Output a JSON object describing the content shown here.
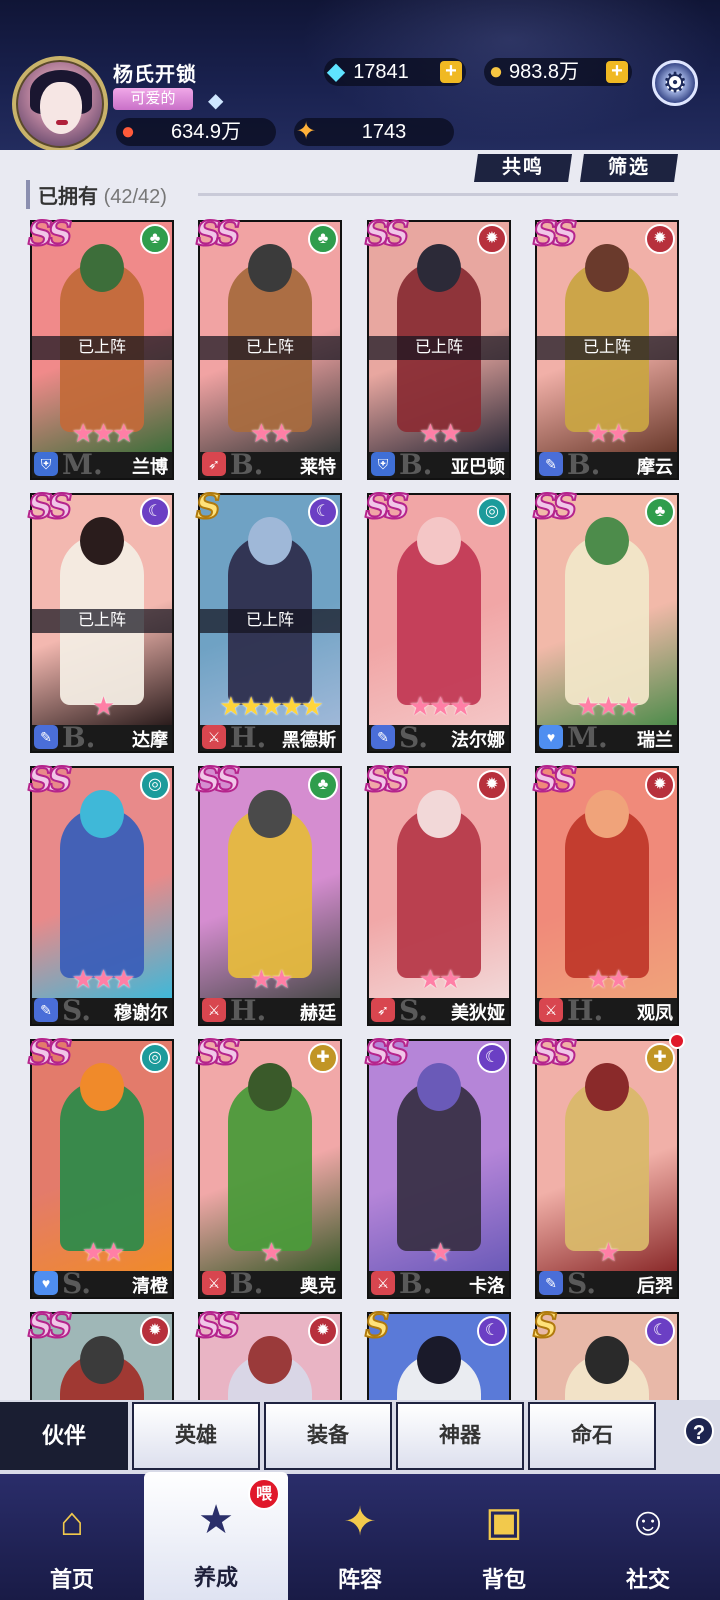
{
  "player": {
    "name": "杨氏开锁",
    "title": "可爱的",
    "rank_icon": "diamond-rank-icon"
  },
  "resources": {
    "gems": "17841",
    "gold": "983.8万",
    "power": "634.9万",
    "stars": "1743"
  },
  "actions": {
    "resonance": "共鸣",
    "filter": "筛选"
  },
  "owned": {
    "label": "已拥有",
    "count": "(42/42)"
  },
  "deployed_text": "已上阵",
  "heroes": [
    {
      "name": "兰博",
      "rank": "SS",
      "element": "nature",
      "cls": "tank",
      "letter": "M.",
      "stars": "★★★",
      "deployed": true
    },
    {
      "name": "莱特",
      "rank": "SS",
      "element": "nature",
      "cls": "ranger",
      "letter": "B.",
      "stars": "★★",
      "deployed": true
    },
    {
      "name": "亚巴顿",
      "rank": "SS",
      "element": "fire",
      "cls": "tank",
      "letter": "B.",
      "stars": "★★",
      "deployed": true
    },
    {
      "name": "摩云",
      "rank": "SS",
      "element": "fire",
      "cls": "mage",
      "letter": "B.",
      "stars": "★★",
      "deployed": true
    },
    {
      "name": "达摩",
      "rank": "SS",
      "element": "moon",
      "cls": "mage",
      "letter": "B.",
      "stars": "★",
      "deployed": true
    },
    {
      "name": "黑德斯",
      "rank": "S",
      "element": "moon",
      "cls": "warrior",
      "letter": "H.",
      "stars": "★★★★★",
      "deployed": true,
      "gold": true
    },
    {
      "name": "法尔娜",
      "rank": "SS",
      "element": "water",
      "cls": "mage",
      "letter": "S.",
      "stars": "★★★",
      "deployed": false
    },
    {
      "name": "瑞兰",
      "rank": "SS",
      "element": "nature",
      "cls": "support",
      "letter": "M.",
      "stars": "★★★",
      "deployed": false
    },
    {
      "name": "穆谢尔",
      "rank": "SS",
      "element": "water",
      "cls": "mage",
      "letter": "S.",
      "stars": "★★★",
      "deployed": false
    },
    {
      "name": "赫廷",
      "rank": "SS",
      "element": "nature",
      "cls": "warrior",
      "letter": "H.",
      "stars": "★★",
      "deployed": false
    },
    {
      "name": "美狄娅",
      "rank": "SS",
      "element": "fire",
      "cls": "ranger",
      "letter": "S.",
      "stars": "★★",
      "deployed": false
    },
    {
      "name": "观凤",
      "rank": "SS",
      "element": "fire",
      "cls": "warrior",
      "letter": "H.",
      "stars": "★★",
      "deployed": false
    },
    {
      "name": "清橙",
      "rank": "SS",
      "element": "water",
      "cls": "support",
      "letter": "S.",
      "stars": "★★",
      "deployed": false
    },
    {
      "name": "奥克",
      "rank": "SS",
      "element": "light",
      "cls": "warrior",
      "letter": "B.",
      "stars": "★",
      "deployed": false
    },
    {
      "name": "卡洛",
      "rank": "SS",
      "element": "moon",
      "cls": "warrior",
      "letter": "B.",
      "stars": "★",
      "deployed": false
    },
    {
      "name": "后羿",
      "rank": "SS",
      "element": "light",
      "cls": "mage",
      "letter": "S.",
      "stars": "★",
      "deployed": false,
      "dot": true
    },
    {
      "name": "",
      "rank": "SS",
      "element": "fire",
      "cls": "",
      "letter": "",
      "stars": "",
      "deployed": false
    },
    {
      "name": "",
      "rank": "SS",
      "element": "fire",
      "cls": "",
      "letter": "",
      "stars": "",
      "deployed": false
    },
    {
      "name": "",
      "rank": "S",
      "element": "moon",
      "cls": "",
      "letter": "",
      "stars": "",
      "deployed": false
    },
    {
      "name": "",
      "rank": "S",
      "element": "moon",
      "cls": "",
      "letter": "",
      "stars": "",
      "deployed": false
    }
  ],
  "subtabs": [
    {
      "label": "伙伴",
      "active": true,
      "dot": false
    },
    {
      "label": "英雄",
      "active": false,
      "dot": true
    },
    {
      "label": "装备",
      "active": false,
      "dot": true
    },
    {
      "label": "神器",
      "active": false,
      "dot": true
    },
    {
      "label": "命石",
      "active": false,
      "dot": false
    }
  ],
  "help_label": "?",
  "nav": [
    {
      "label": "首页",
      "icon": "home-icon",
      "active": false
    },
    {
      "label": "养成",
      "icon": "develop-icon",
      "active": true,
      "badge": "喂"
    },
    {
      "label": "阵容",
      "icon": "lineup-icon",
      "active": false
    },
    {
      "label": "背包",
      "icon": "backpack-icon",
      "active": false
    },
    {
      "label": "社交",
      "icon": "social-icon",
      "active": false
    }
  ]
}
